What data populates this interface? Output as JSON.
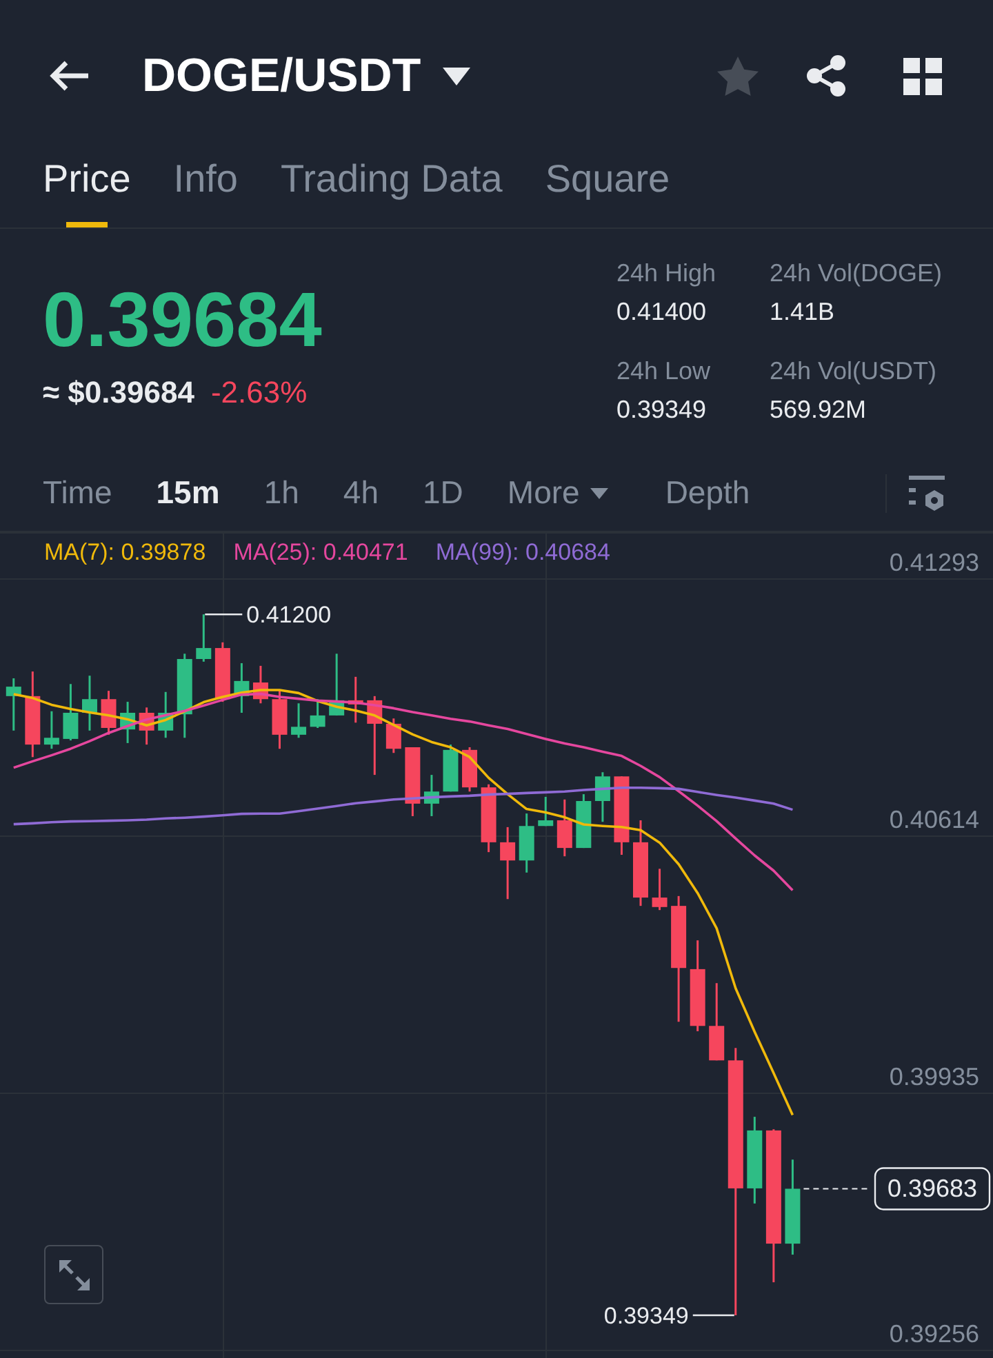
{
  "header": {
    "title": "DOGE/USDT"
  },
  "tabs": [
    {
      "label": "Price",
      "selected": true
    },
    {
      "label": "Info",
      "selected": false
    },
    {
      "label": "Trading Data",
      "selected": false
    },
    {
      "label": "Square",
      "selected": false
    }
  ],
  "ticker": {
    "last_price": "0.39684",
    "usd_price": "≈ $0.39684",
    "change": "-2.63%"
  },
  "stats": [
    {
      "label": "24h High",
      "value": "0.41400"
    },
    {
      "label": "24h Vol(DOGE)",
      "value": "1.41B"
    },
    {
      "label": "24h Low",
      "value": "0.39349"
    },
    {
      "label": "24h Vol(USDT)",
      "value": "569.92M"
    }
  ],
  "intervals": [
    {
      "label": "Time",
      "kind": "option",
      "selected": false
    },
    {
      "label": "15m",
      "kind": "option",
      "selected": true
    },
    {
      "label": "1h",
      "kind": "option",
      "selected": false
    },
    {
      "label": "4h",
      "kind": "option",
      "selected": false
    },
    {
      "label": "1D",
      "kind": "option",
      "selected": false
    },
    {
      "label": "More",
      "kind": "dropdown",
      "selected": false
    },
    {
      "label": "Depth",
      "kind": "option",
      "selected": false
    }
  ],
  "chart": {
    "chart_data": {
      "type": "candlestick",
      "grid": true,
      "categories": [
        null,
        null,
        null,
        null,
        null,
        null,
        null,
        null,
        null,
        null,
        null,
        null,
        null,
        null,
        null,
        null,
        null,
        null,
        null,
        null,
        null,
        null,
        null,
        null,
        null,
        null,
        null,
        null,
        null,
        null,
        null,
        null,
        null,
        null,
        null,
        null,
        null,
        null,
        null,
        null,
        null,
        null
      ],
      "ylim": [
        0.39236,
        0.41417
      ],
      "yticks": [
        {
          "value": 0.41293,
          "label": "0.41293"
        },
        {
          "value": 0.40614,
          "label": "0.40614"
        },
        {
          "value": 0.39935,
          "label": "0.39935"
        },
        {
          "value": 0.39256,
          "label": "0.39256"
        }
      ],
      "ohlc": [
        [
          0.40984,
          0.41031,
          0.40893,
          0.41009
        ],
        [
          0.40984,
          0.41049,
          0.40823,
          0.40856
        ],
        [
          0.40856,
          0.40944,
          0.40845,
          0.40874
        ],
        [
          0.40871,
          0.41016,
          0.40867,
          0.4094
        ],
        [
          0.4094,
          0.41038,
          0.40893,
          0.40976
        ],
        [
          0.40976,
          0.40998,
          0.40882,
          0.409
        ],
        [
          0.40896,
          0.40969,
          0.4086,
          0.4094
        ],
        [
          0.4094,
          0.40954,
          0.40856,
          0.40893
        ],
        [
          0.40893,
          0.40995,
          0.40874,
          0.4094
        ],
        [
          0.40936,
          0.41096,
          0.40874,
          0.41082
        ],
        [
          0.41082,
          0.412,
          0.41075,
          0.41111
        ],
        [
          0.41111,
          0.41126,
          0.40969,
          0.40976
        ],
        [
          0.40984,
          0.41071,
          0.4094,
          0.41024
        ],
        [
          0.4102,
          0.41064,
          0.40965,
          0.40976
        ],
        [
          0.40976,
          0.40998,
          0.40845,
          0.40882
        ],
        [
          0.40882,
          0.40965,
          0.40874,
          0.40903
        ],
        [
          0.40903,
          0.40976,
          0.409,
          0.40933
        ],
        [
          0.40933,
          0.41096,
          0.40933,
          0.40973
        ],
        [
          0.40973,
          0.41035,
          0.40914,
          0.40962
        ],
        [
          0.40973,
          0.40984,
          0.40776,
          0.40911
        ],
        [
          0.40911,
          0.40925,
          0.40834,
          0.40845
        ],
        [
          0.40849,
          0.40849,
          0.40667,
          0.407
        ],
        [
          0.407,
          0.40776,
          0.40667,
          0.40732
        ],
        [
          0.40732,
          0.40856,
          0.40732,
          0.40842
        ],
        [
          0.40842,
          0.40849,
          0.40732,
          0.40743
        ],
        [
          0.40743,
          0.40751,
          0.40572,
          0.40598
        ],
        [
          0.40598,
          0.40638,
          0.40448,
          0.4055
        ],
        [
          0.4055,
          0.40674,
          0.40518,
          0.40641
        ],
        [
          0.40641,
          0.40718,
          0.40641,
          0.40656
        ],
        [
          0.40656,
          0.40711,
          0.40561,
          0.40583
        ],
        [
          0.40583,
          0.40725,
          0.40583,
          0.40707
        ],
        [
          0.40707,
          0.40783,
          0.40652,
          0.40772
        ],
        [
          0.40772,
          0.40772,
          0.40565,
          0.40598
        ],
        [
          0.40598,
          0.40656,
          0.4043,
          0.40452
        ],
        [
          0.40452,
          0.40528,
          0.40419,
          0.40427
        ],
        [
          0.4043,
          0.40456,
          0.40124,
          0.40266
        ],
        [
          0.40263,
          0.40339,
          0.40099,
          0.40113
        ],
        [
          0.40113,
          0.40226,
          0.40022,
          0.40022
        ],
        [
          0.40022,
          0.40055,
          0.39349,
          0.39684
        ],
        [
          0.39684,
          0.39873,
          0.39644,
          0.39837
        ],
        [
          0.39837,
          0.3984,
          0.39436,
          0.39538
        ],
        [
          0.39538,
          0.3976,
          0.39509,
          0.39683
        ]
      ],
      "series": [
        {
          "name": "MA(7): 0.39878",
          "type": "line",
          "color": "#f0b90b",
          "values": [
            0.40989,
            0.40979,
            0.40961,
            0.4095,
            0.40941,
            0.40933,
            0.40923,
            0.40907,
            0.40921,
            0.40944,
            0.40968,
            0.40982,
            0.40993,
            0.41,
            0.41,
            0.40992,
            0.40971,
            0.40956,
            0.40946,
            0.40933,
            0.40908,
            0.40883,
            0.40863,
            0.40849,
            0.40823,
            0.40768,
            0.40725,
            0.40686,
            0.40677,
            0.40664,
            0.40645,
            0.40641,
            0.40638,
            0.4063,
            0.40597,
            0.4054,
            0.40464,
            0.40371,
            0.40212,
            0.40097,
            0.39989,
            0.39878
          ]
        },
        {
          "name": "MA(25): 0.40471",
          "type": "line",
          "color": "#e5479e",
          "values": [
            0.40795,
            0.40812,
            0.40828,
            0.40845,
            0.40865,
            0.40887,
            0.40905,
            0.40922,
            0.40934,
            0.40945,
            0.40959,
            0.40974,
            0.40988,
            0.4099,
            0.40982,
            0.40977,
            0.40972,
            0.4097,
            0.40967,
            0.4096,
            0.40952,
            0.40942,
            0.40933,
            0.40924,
            0.40917,
            0.40907,
            0.40897,
            0.40884,
            0.40871,
            0.40859,
            0.40849,
            0.40837,
            0.40826,
            0.408,
            0.4077,
            0.40733,
            0.40695,
            0.40654,
            0.40608,
            0.40563,
            0.40523,
            0.40471
          ]
        },
        {
          "name": "MA(99): 0.40684",
          "type": "line",
          "color": "#8f6bd5",
          "values": [
            0.40646,
            0.40648,
            0.40651,
            0.40653,
            0.40654,
            0.40655,
            0.40656,
            0.40658,
            0.40661,
            0.40663,
            0.40666,
            0.40669,
            0.40673,
            0.40674,
            0.40674,
            0.4068,
            0.40687,
            0.40694,
            0.40701,
            0.40706,
            0.40711,
            0.40714,
            0.40717,
            0.40719,
            0.40721,
            0.40724,
            0.40726,
            0.40728,
            0.4073,
            0.40732,
            0.40736,
            0.40739,
            0.40742,
            0.40742,
            0.40741,
            0.40739,
            0.40731,
            0.40723,
            0.40716,
            0.40708,
            0.407,
            0.40684
          ]
        }
      ]
    },
    "high_marker": "0.41200",
    "low_marker": "0.39349",
    "last_price_tag": "0.39683"
  }
}
